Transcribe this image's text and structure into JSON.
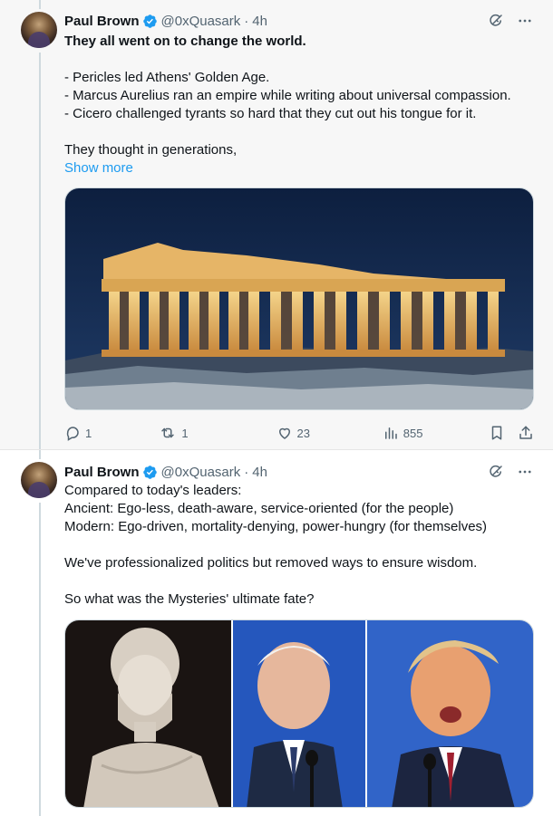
{
  "tweets": [
    {
      "author": {
        "name": "Paul Brown",
        "handle": "@0xQuasark",
        "time": "4h",
        "verified": true
      },
      "lead": "They all went on to change the world.",
      "lines": [
        "- Pericles led Athens' Golden Age.",
        "- Marcus Aurelius ran an empire while writing about universal compassion.",
        "- Cicero challenged tyrants so hard that they cut out his tongue for it."
      ],
      "closing": "They thought in generations,",
      "show_more": "Show more",
      "media": {
        "description_icon": "parthenon-photo"
      },
      "stats": {
        "replies": "1",
        "reposts": "1",
        "likes": "23",
        "views": "855"
      }
    },
    {
      "author": {
        "name": "Paul Brown",
        "handle": "@0xQuasark",
        "time": "4h",
        "verified": true
      },
      "lines": [
        "Compared to today's leaders:",
        "Ancient: Ego-less, death-aware, service-oriented (for the people)",
        "Modern: Ego-driven, mortality-denying, power-hungry (for themselves)"
      ],
      "para2": "We've professionalized politics but removed ways to ensure wisdom.",
      "para3": "So what was the Mysteries' ultimate fate?",
      "media": {
        "description_icon": "leaders-collage-photo"
      }
    }
  ],
  "colors": {
    "accent": "#1d9bf0",
    "muted": "#536471",
    "text": "#0f1419"
  },
  "icons": [
    "verified-badge-icon",
    "grok-icon",
    "more-icon",
    "reply-icon",
    "repost-icon",
    "like-icon",
    "views-icon",
    "bookmark-icon",
    "share-icon"
  ]
}
